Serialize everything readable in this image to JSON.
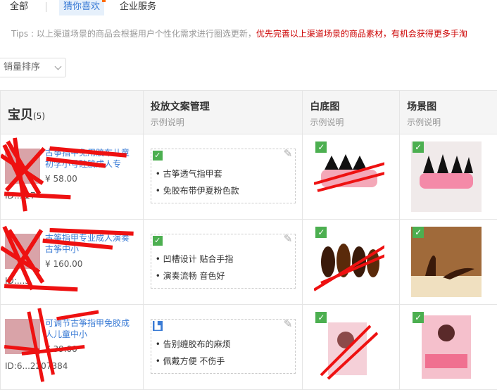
{
  "tabs": {
    "all": "全部",
    "guess": "猜你喜欢",
    "biz": "企业服务"
  },
  "tips": {
    "prefix": "Tips : 以上渠道场景的商品会根据用户个性化需求进行圈选更新，",
    "highlight": "优先完善以上渠道场景的商品素材，有机会获得更多手淘"
  },
  "sort": {
    "label": "销量排序"
  },
  "table": {
    "headers": {
      "baby": "宝贝",
      "count": "(5)",
      "copy": "投放文案管理",
      "copy_sub": "示例说明",
      "white": "白底图",
      "white_sub": "示例说明",
      "scene": "场景图",
      "scene_sub": "示例说明"
    },
    "rows": [
      {
        "title": "古筝指甲免用胶布儿童初学小号硅胶成人专",
        "price": "¥ 58.00",
        "id": "ID:...27",
        "lines": [
          "古筝透气指甲套",
          "免胶布带伊夏粉色款"
        ],
        "status": "green"
      },
      {
        "title": "古筝指甲专业成人演奏古筝中小",
        "price": "¥ 160.00",
        "id": "ID:...3",
        "lines": [
          "凹槽设计 贴合手指",
          "演奏流畅 音色好"
        ],
        "status": "green"
      },
      {
        "title": "可调节古筝指甲免胶成人儿童中小",
        "price": "¥ 39.00",
        "id": "ID:6...2207384",
        "lines": [
          "告别缠胶布的麻烦",
          "佩戴方便 不伤手"
        ],
        "status": "blue"
      }
    ]
  },
  "colors": {
    "accent": "#3a7bd5",
    "warn": "#cc0000",
    "check": "#4caf50",
    "scribble": "#ee1111"
  }
}
